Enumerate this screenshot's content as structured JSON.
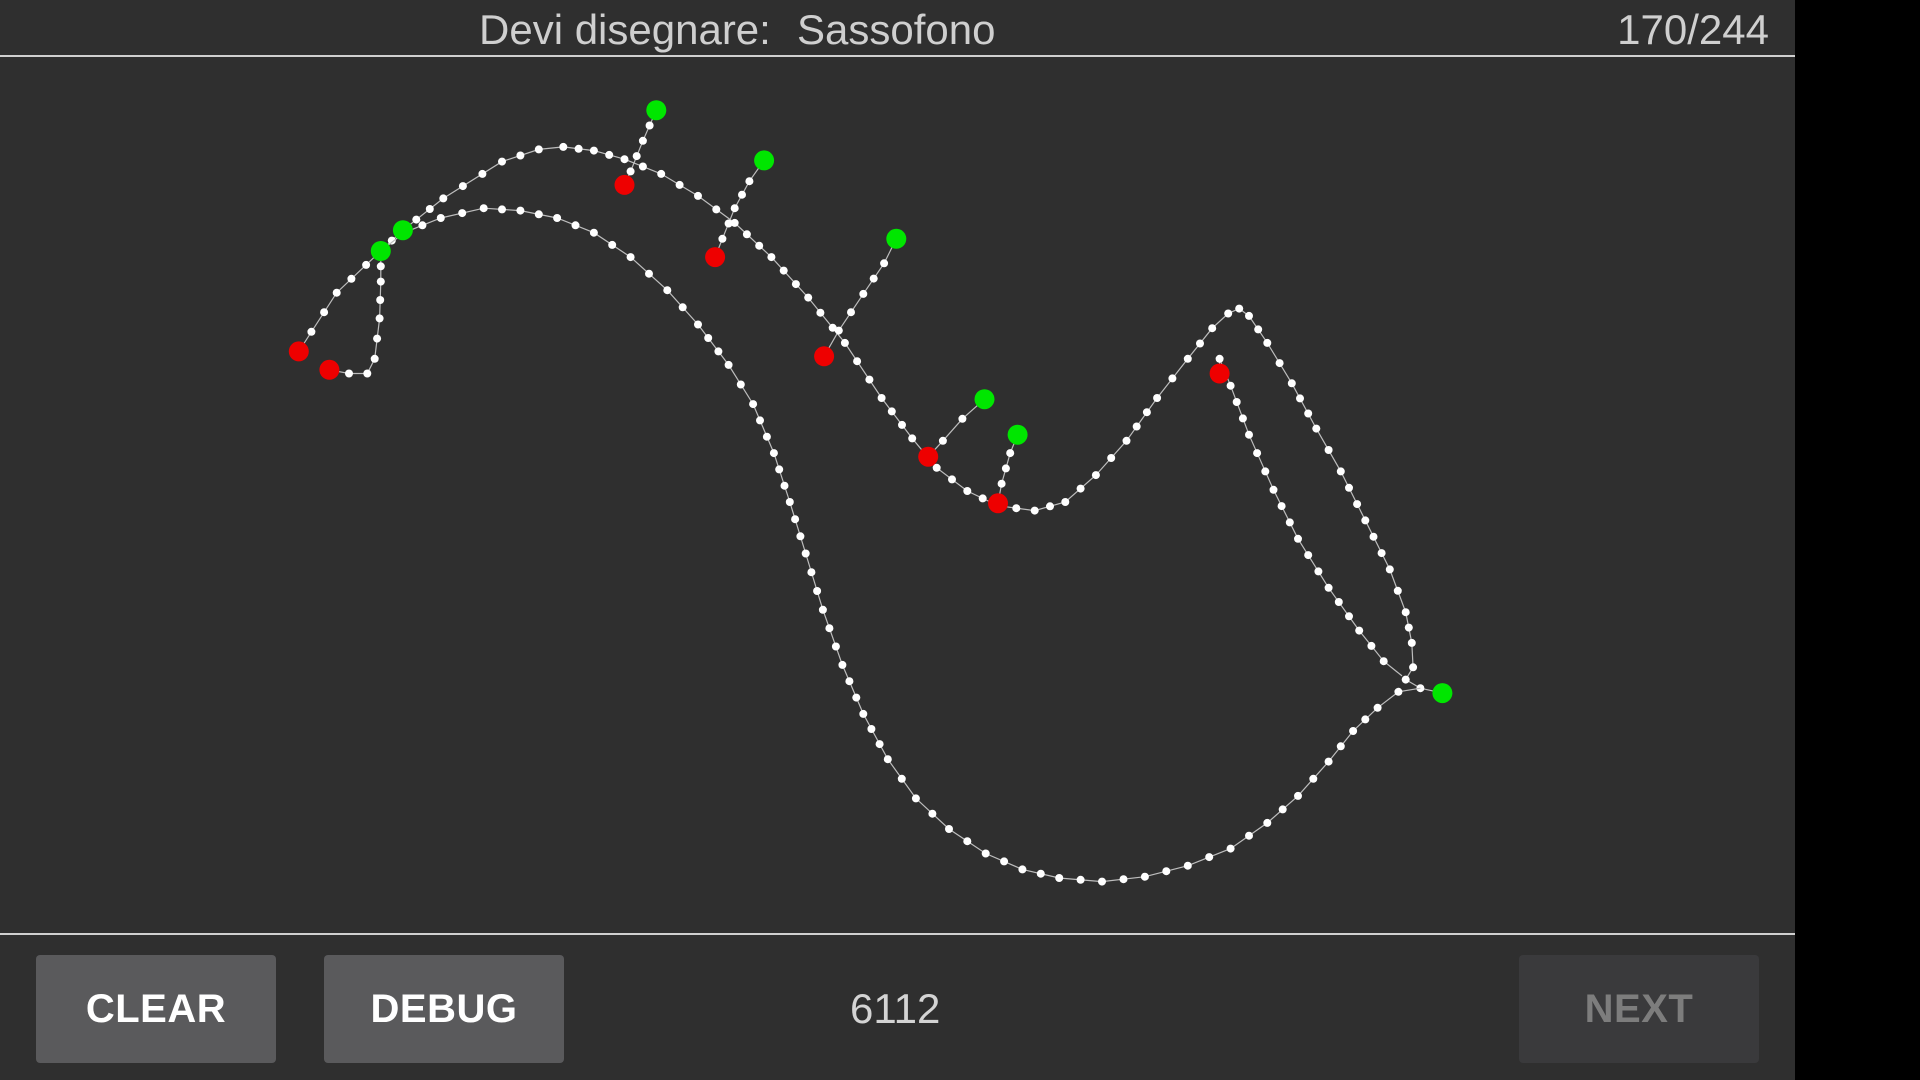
{
  "header": {
    "prompt_label": "Devi disegnare:",
    "prompt_word": "Sassofono",
    "counter": "170/244"
  },
  "footer": {
    "clear_label": "CLEAR",
    "debug_label": "DEBUG",
    "score": "6112",
    "next_label": "NEXT"
  },
  "colors": {
    "background": "#2f2f2f",
    "stroke": "#ffffff",
    "stroke_start": "#00e600",
    "stroke_end": "#ee0000",
    "button": "#5a5a5c",
    "button_disabled": "#3a3a3c"
  }
}
